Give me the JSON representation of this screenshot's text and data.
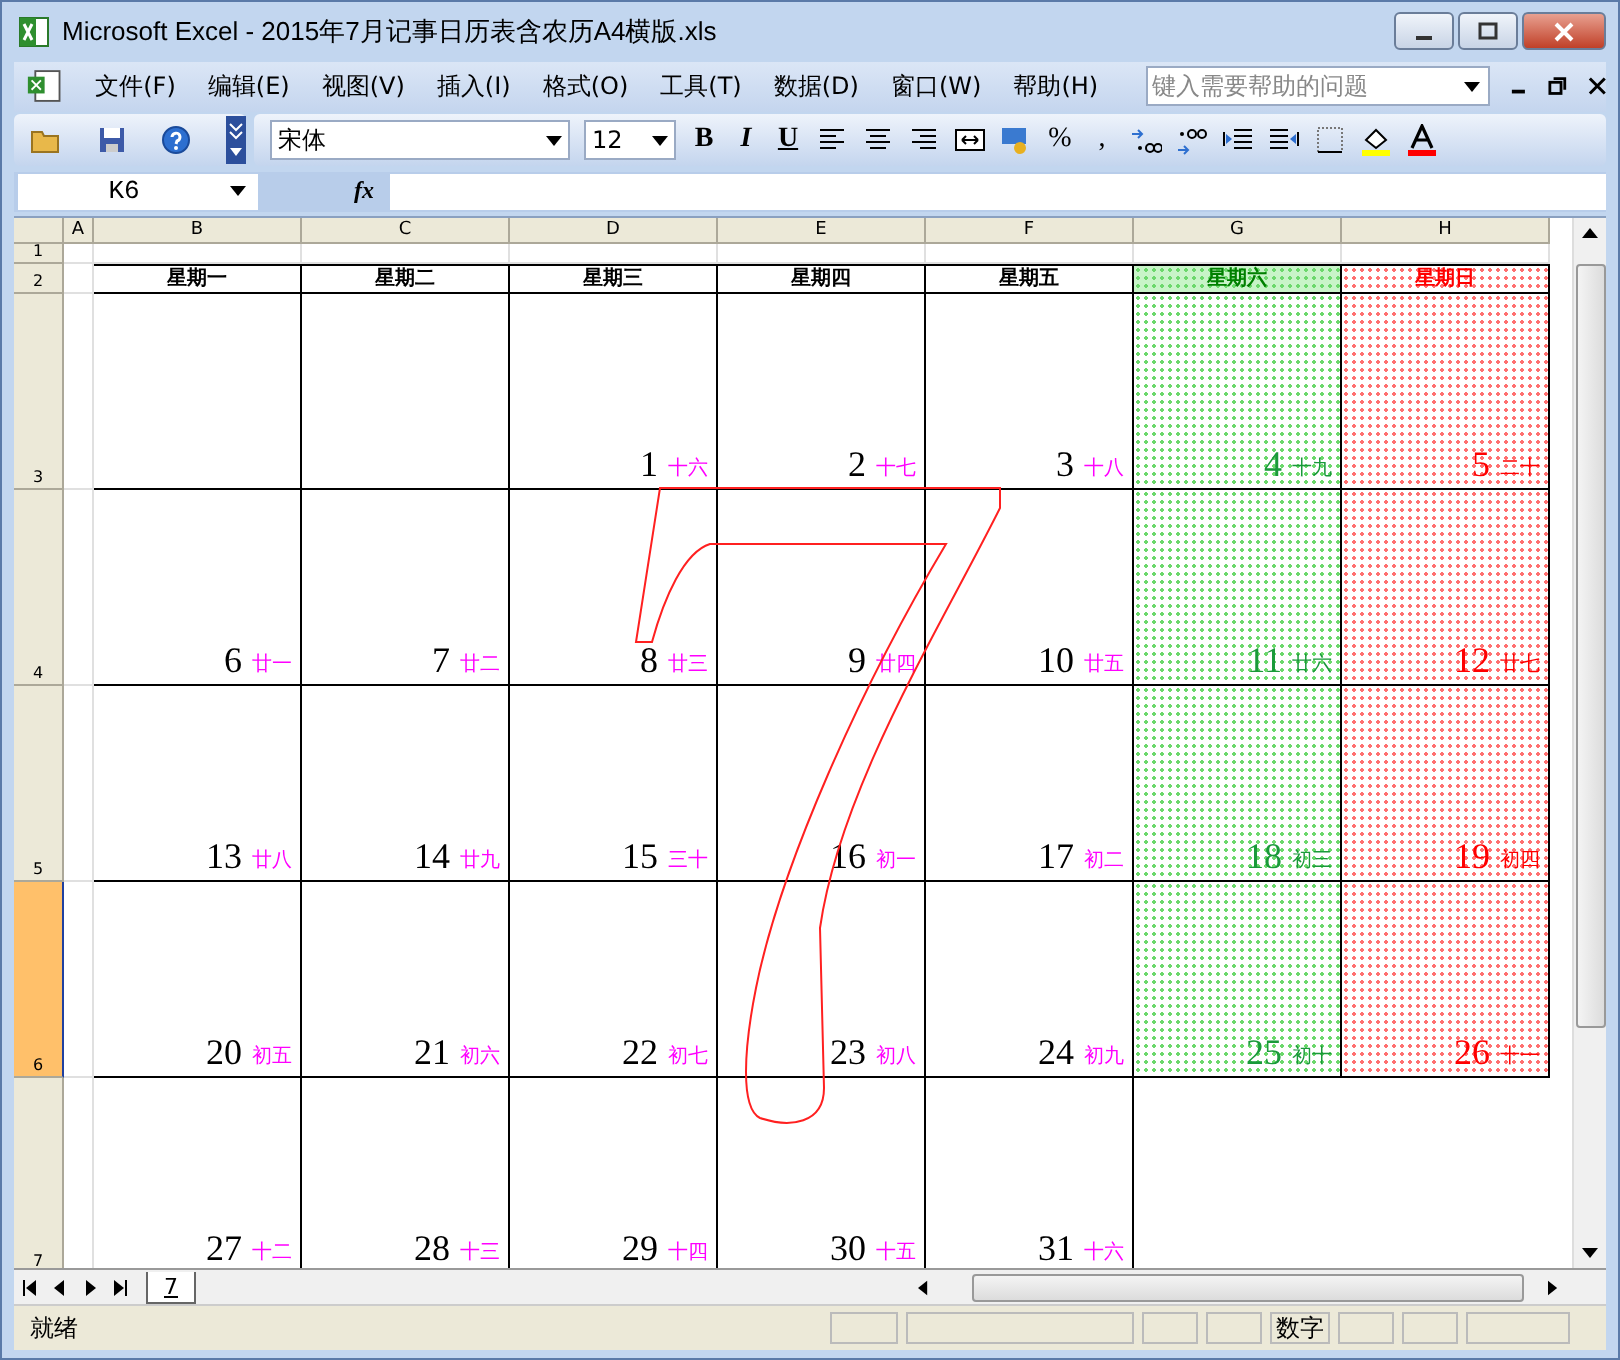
{
  "window": {
    "title": "Microsoft Excel - 2015年7月记事日历表含农历A4横版.xls"
  },
  "menu": [
    {
      "label": "文件(F)"
    },
    {
      "label": "编辑(E)"
    },
    {
      "label": "视图(V)"
    },
    {
      "label": "插入(I)"
    },
    {
      "label": "格式(O)"
    },
    {
      "label": "工具(T)"
    },
    {
      "label": "数据(D)"
    },
    {
      "label": "窗口(W)"
    },
    {
      "label": "帮助(H)"
    }
  ],
  "help_box": {
    "placeholder": "键入需要帮助的问题"
  },
  "toolbar": {
    "font": "宋体",
    "size": "12",
    "styles": [
      "B",
      "I",
      "U"
    ],
    "percent": "%",
    "comma": ","
  },
  "formula_bar": {
    "cell": "K6",
    "fx": "fx"
  },
  "columns": [
    {
      "label": "A",
      "kind": "narrow"
    },
    {
      "label": "B",
      "kind": "wide"
    },
    {
      "label": "C",
      "kind": "wide"
    },
    {
      "label": "D",
      "kind": "wide"
    },
    {
      "label": "E",
      "kind": "wide"
    },
    {
      "label": "F",
      "kind": "wide"
    },
    {
      "label": "G",
      "kind": "wide"
    },
    {
      "label": "H",
      "kind": "wide"
    }
  ],
  "rows": [
    {
      "label": "1",
      "selected": false,
      "kind": "spacer"
    },
    {
      "label": "2",
      "selected": false,
      "kind": "header",
      "cells": [
        {
          "label": "星期一",
          "kind": "weekday"
        },
        {
          "label": "星期二",
          "kind": "weekday"
        },
        {
          "label": "星期三",
          "kind": "weekday"
        },
        {
          "label": "星期四",
          "kind": "weekday"
        },
        {
          "label": "星期五",
          "kind": "weekday"
        },
        {
          "label": "星期六",
          "kind": "saturday"
        },
        {
          "label": "星期日",
          "kind": "sunday"
        }
      ]
    },
    {
      "label": "3",
      "selected": false,
      "kind": "week",
      "cells": [
        null,
        null,
        {
          "day": "1",
          "lunar": "十六"
        },
        {
          "day": "2",
          "lunar": "十七"
        },
        {
          "day": "3",
          "lunar": "十八"
        },
        {
          "day": "4",
          "lunar": "十九"
        },
        {
          "day": "5",
          "lunar": "二十"
        }
      ]
    },
    {
      "label": "4",
      "selected": false,
      "kind": "week",
      "cells": [
        {
          "day": "6",
          "lunar": "廿一"
        },
        {
          "day": "7",
          "lunar": "廿二"
        },
        {
          "day": "8",
          "lunar": "廿三"
        },
        {
          "day": "9",
          "lunar": "廿四"
        },
        {
          "day": "10",
          "lunar": "廿五"
        },
        {
          "day": "11",
          "lunar": "廿六"
        },
        {
          "day": "12",
          "lunar": "廿七"
        }
      ]
    },
    {
      "label": "5",
      "selected": false,
      "kind": "week",
      "cells": [
        {
          "day": "13",
          "lunar": "廿八"
        },
        {
          "day": "14",
          "lunar": "廿九"
        },
        {
          "day": "15",
          "lunar": "三十"
        },
        {
          "day": "16",
          "lunar": "初一"
        },
        {
          "day": "17",
          "lunar": "初二"
        },
        {
          "day": "18",
          "lunar": "初三"
        },
        {
          "day": "19",
          "lunar": "初四"
        }
      ]
    },
    {
      "label": "6",
      "selected": true,
      "kind": "week",
      "cells": [
        {
          "day": "20",
          "lunar": "初五"
        },
        {
          "day": "21",
          "lunar": "初六"
        },
        {
          "day": "22",
          "lunar": "初七"
        },
        {
          "day": "23",
          "lunar": "初八"
        },
        {
          "day": "24",
          "lunar": "初九"
        },
        {
          "day": "25",
          "lunar": "初十"
        },
        {
          "day": "26",
          "lunar": "十一"
        }
      ]
    },
    {
      "label": "7",
      "selected": false,
      "kind": "week",
      "cells": [
        {
          "day": "27",
          "lunar": "十二"
        },
        {
          "day": "28",
          "lunar": "十三"
        },
        {
          "day": "29",
          "lunar": "十四"
        },
        {
          "day": "30",
          "lunar": "十五"
        },
        {
          "day": "31",
          "lunar": "十六"
        },
        null,
        null
      ]
    }
  ],
  "sheet_tabs": [
    {
      "label": "7",
      "selected": true
    }
  ],
  "status": {
    "text": "就绪",
    "mode": "数字"
  }
}
